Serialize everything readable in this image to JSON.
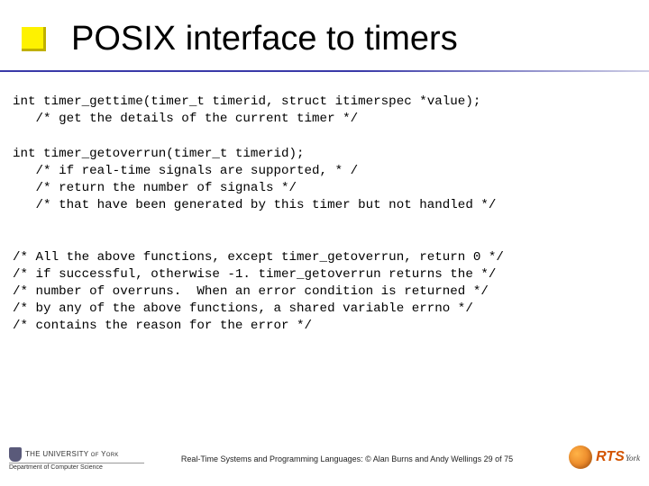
{
  "title": "POSIX interface to timers",
  "code": "int timer_gettime(timer_t timerid, struct itimerspec *value);\n   /* get the details of the current timer */\n\nint timer_getoverrun(timer_t timerid);\n   /* if real-time signals are supported, * /\n   /* return the number of signals */\n   /* that have been generated by this timer but not handled */\n\n\n/* All the above functions, except timer_getoverrun, return 0 */\n/* if successful, otherwise -1. timer_getoverrun returns the */\n/* number of overruns.  When an error condition is returned */\n/* by any of the above functions, a shared variable errno */\n/* contains the reason for the error */",
  "footer": {
    "university_line": "THE UNIVERSITY of York",
    "department": "Department of Computer Science",
    "caption": "Real-Time Systems and Programming Languages: © Alan Burns and Andy Wellings 29 of 75",
    "logo_text": "RTS",
    "logo_sub": "York"
  }
}
